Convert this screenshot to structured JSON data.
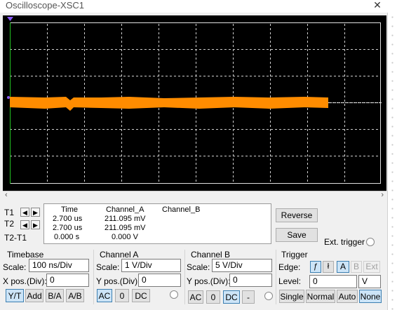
{
  "window": {
    "title": "Oscilloscope-XSC1",
    "close_glyph": "✕"
  },
  "cursors": {
    "t1_label": "T1",
    "t2_label": "T2",
    "t2t1_label": "T2-T1"
  },
  "readout": {
    "headers": [
      "Time",
      "Channel_A",
      "Channel_B"
    ],
    "rows": [
      [
        "2.700 us",
        "211.095 mV",
        ""
      ],
      [
        "2.700 us",
        "211.095 mV",
        ""
      ],
      [
        "0.000 s",
        "0.000 V",
        ""
      ]
    ]
  },
  "actions": {
    "reverse": "Reverse",
    "save": "Save",
    "ext_trigger": "Ext. trigger"
  },
  "timebase": {
    "title": "Timebase",
    "scale_label": "Scale:",
    "scale_value": "100 ns/Div",
    "xpos_label": "X pos.(Div):",
    "xpos_value": "0",
    "modes": [
      "Y/T",
      "Add",
      "B/A",
      "A/B"
    ],
    "selected_mode": "Y/T"
  },
  "channel_a": {
    "title": "Channel A",
    "scale_label": "Scale:",
    "scale_value": "1  V/Div",
    "ypos_label": "Y pos.(Div):",
    "ypos_value": "0",
    "coupling": [
      "AC",
      "0",
      "DC"
    ],
    "selected": "AC"
  },
  "channel_b": {
    "title": "Channel B",
    "scale_label": "Scale:",
    "scale_value": "5  V/Div",
    "ypos_label": "Y pos.(Div):",
    "ypos_value": "0",
    "coupling": [
      "AC",
      "0",
      "DC",
      "-"
    ],
    "selected": "DC"
  },
  "trigger": {
    "title": "Trigger",
    "edge_label": "Edge:",
    "edge_rise_glyph": "ƒ",
    "edge_fall_glyph": "ł",
    "sources": [
      "A",
      "B",
      "Ext"
    ],
    "selected_source": "A",
    "level_label": "Level:",
    "level_value": "0",
    "level_unit": "V",
    "modes": [
      "Single",
      "Normal",
      "Auto",
      "None"
    ],
    "selected_mode": "None"
  },
  "colors": {
    "trace": "#ff8c00",
    "grid": "#cfcfcf",
    "screen": "#000000",
    "selected_button": "#cce4f7"
  },
  "icons": [
    "left-arrow-icon",
    "right-arrow-icon",
    "scroll-left-icon",
    "scroll-right-icon",
    "cursor-marker-icon"
  ]
}
